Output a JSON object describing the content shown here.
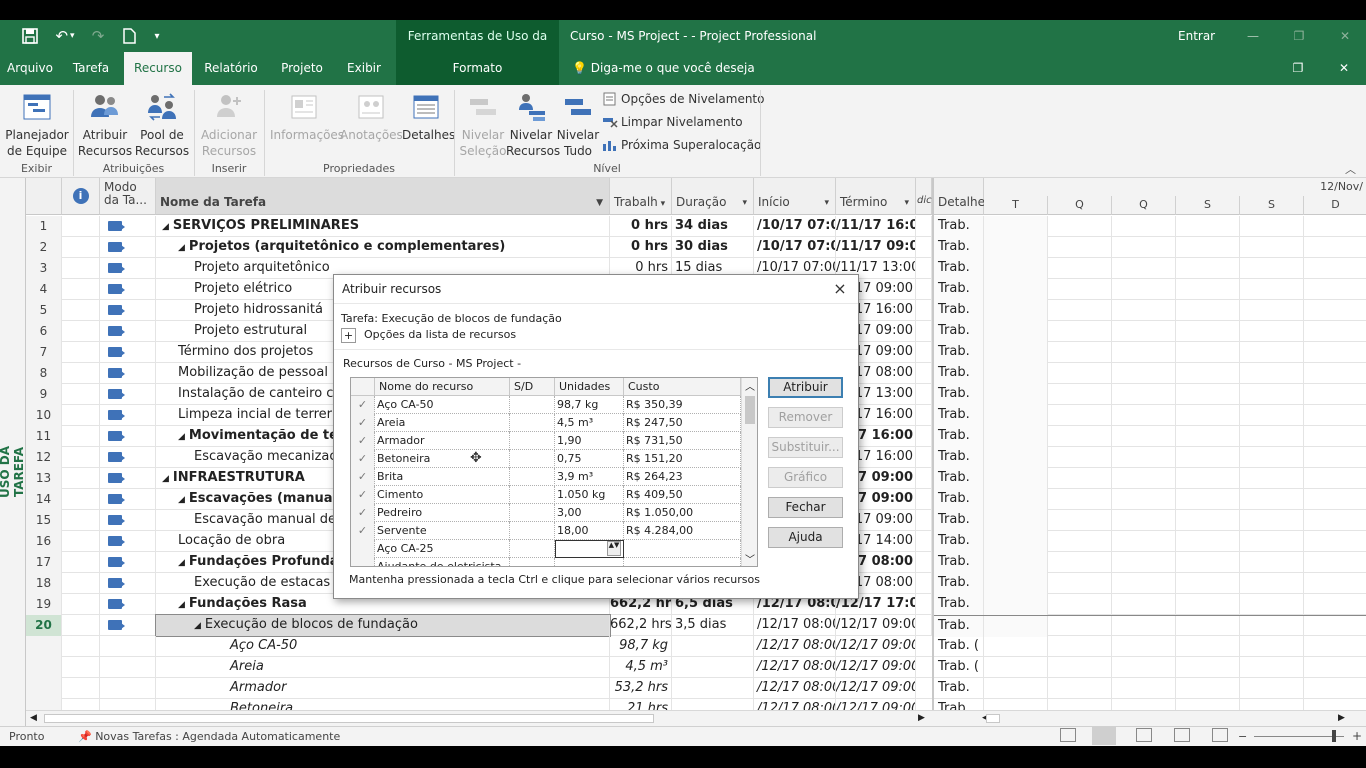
{
  "quick_access": {
    "save_icon": "save-icon",
    "undo_icon": "undo-icon",
    "redo_icon": "redo-icon",
    "new_icon": "new-file-icon",
    "customize_icon": "customize-qat-icon"
  },
  "window": {
    "contextual_header": "Ferramentas de Uso da Tarefa",
    "title": "Curso - MS Project -  -  Project Professional",
    "signin": "Entrar"
  },
  "tabs": [
    "Arquivo",
    "Tarefa",
    "Recurso",
    "Relatório",
    "Projeto",
    "Exibir"
  ],
  "contextual_tab": "Formato",
  "tell_me": "Diga-me o que você deseja fazer",
  "ribbon": {
    "team_planner": "Planejador\nde Equipe",
    "assign_resources": "Atribuir\nRecursos",
    "resource_pool": "Pool de\nRecursos",
    "add_resources": "Adicionar\nRecursos",
    "information": "Informações",
    "notes": "Anotações",
    "details": "Detalhes",
    "level_selection": "Nivelar\nSeleção",
    "level_resources": "Nivelar\nRecursos",
    "level_all": "Nivelar\nTudo",
    "leveling_options": "Opções de Nivelamento",
    "clear_leveling": "Limpar Nivelamento",
    "next_overallocation": "Próxima Superalocação",
    "groups": {
      "view": "Exibir",
      "assignments": "Atribuições",
      "insert": "Inserir",
      "properties": "Propriedades",
      "level": "Nível"
    }
  },
  "view_label": "USO DA TAREFA",
  "grid": {
    "headers": {
      "info": "i",
      "mode": "Modo da Ta...",
      "name": "Nome da Tarefa",
      "work": "Trabalh",
      "duration": "Duração",
      "start": "Início",
      "finish": "Término",
      "extra": "dic",
      "detail": "Detalhe"
    },
    "rows": [
      {
        "id": "1",
        "name": "SERVIÇOS PRELIMINARES",
        "level": 0,
        "bold": true,
        "work": "0 hrs",
        "duration": "34 dias",
        "start": "/10/17 07:00",
        "finish": "/11/17 16:00",
        "detail": "Trab."
      },
      {
        "id": "2",
        "name": "Projetos (arquitetônico e complementares)",
        "level": 1,
        "bold": true,
        "work": "0 hrs",
        "duration": "30 dias",
        "start": "/10/17 07:00",
        "finish": "/11/17 09:00",
        "detail": "Trab."
      },
      {
        "id": "3",
        "name": "Projeto arquitetônico",
        "level": 2,
        "bold": false,
        "work": "0 hrs",
        "duration": "15 dias",
        "start": "/10/17 07:00",
        "finish": "/11/17 13:00",
        "detail": "Trab."
      },
      {
        "id": "4",
        "name": "Projeto elétrico",
        "level": 2,
        "bold": false,
        "work": "",
        "duration": "",
        "start": "",
        "finish": "/17 09:00",
        "detail": "Trab."
      },
      {
        "id": "5",
        "name": "Projeto hidrossanitá",
        "level": 2,
        "bold": false,
        "work": "",
        "duration": "",
        "start": "",
        "finish": "/17 16:00",
        "detail": "Trab."
      },
      {
        "id": "6",
        "name": "Projeto estrutural",
        "level": 2,
        "bold": false,
        "work": "",
        "duration": "",
        "start": "",
        "finish": "/17 09:00",
        "detail": "Trab."
      },
      {
        "id": "7",
        "name": "Término dos projetos",
        "level": 1,
        "bold": false,
        "work": "",
        "duration": "",
        "start": "",
        "finish": "/17 09:00",
        "detail": "Trab."
      },
      {
        "id": "8",
        "name": "Mobilização de pessoal",
        "level": 1,
        "bold": false,
        "work": "",
        "duration": "",
        "start": "",
        "finish": "/17 08:00",
        "detail": "Trab."
      },
      {
        "id": "9",
        "name": "Instalação de canteiro c",
        "level": 1,
        "bold": false,
        "work": "",
        "duration": "",
        "start": "",
        "finish": "/17 13:00",
        "detail": "Trab."
      },
      {
        "id": "10",
        "name": "Limpeza incial de terrer",
        "level": 1,
        "bold": false,
        "work": "",
        "duration": "",
        "start": "",
        "finish": "/17 16:00",
        "detail": "Trab."
      },
      {
        "id": "11",
        "name": "Movimentação de terra",
        "level": 1,
        "bold": true,
        "work": "",
        "duration": "",
        "start": "",
        "finish": "/17 16:00",
        "detail": "Trab."
      },
      {
        "id": "12",
        "name": "Escavação mecanizac",
        "level": 2,
        "bold": false,
        "work": "",
        "duration": "",
        "start": "",
        "finish": "/17 16:00",
        "detail": "Trab."
      },
      {
        "id": "13",
        "name": "INFRAESTRUTURA",
        "level": 0,
        "bold": true,
        "work": "",
        "duration": "",
        "start": "",
        "finish": "/17 09:00",
        "detail": "Trab."
      },
      {
        "id": "14",
        "name": "Escavações (manual ou",
        "level": 1,
        "bold": true,
        "work": "",
        "duration": "",
        "start": "",
        "finish": "/17 09:00",
        "detail": "Trab."
      },
      {
        "id": "15",
        "name": "Escavação manual de",
        "level": 2,
        "bold": false,
        "work": "",
        "duration": "",
        "start": "",
        "finish": "/17 09:00",
        "detail": "Trab."
      },
      {
        "id": "16",
        "name": "Locação de obra",
        "level": 1,
        "bold": false,
        "work": "",
        "duration": "",
        "start": "",
        "finish": "/17 14:00",
        "detail": "Trab."
      },
      {
        "id": "17",
        "name": "Fundações Profundas",
        "level": 1,
        "bold": true,
        "work": "",
        "duration": "",
        "start": "",
        "finish": "/17 08:00",
        "detail": "Trab."
      },
      {
        "id": "18",
        "name": "Execução de estacas",
        "level": 2,
        "bold": false,
        "work": "",
        "duration": "",
        "start": "",
        "finish": "/17 08:00",
        "detail": "Trab."
      },
      {
        "id": "19",
        "name": "Fundações Rasa",
        "level": 1,
        "bold": true,
        "work": "662,2 hrs",
        "duration": "6,5 dias",
        "start": "/12/17 08:00",
        "finish": "/12/17 17:00",
        "detail": "Trab."
      },
      {
        "id": "20",
        "name": "Execução de blocos de fundação",
        "level": 2,
        "bold": false,
        "work": "662,2 hrs",
        "duration": "3,5 dias",
        "start": "/12/17 08:00",
        "finish": "/12/17 09:00",
        "detail": "Trab."
      }
    ],
    "assignments": [
      {
        "name": "Aço CA-50",
        "work": "98,7 kg",
        "start": "/12/17 08:00",
        "finish": "/12/17 09:00",
        "detail": "Trab. ("
      },
      {
        "name": "Areia",
        "work": "4,5 m³",
        "start": "/12/17 08:00",
        "finish": "/12/17 09:00",
        "detail": "Trab. ("
      },
      {
        "name": "Armador",
        "work": "53,2 hrs",
        "start": "/12/17 08:00",
        "finish": "/12/17 09:00",
        "detail": "Trab."
      },
      {
        "name": "Betoneira",
        "work": "21 hrs",
        "start": "/12/17 08:00",
        "finish": "/12/17 09:00",
        "detail": "Trab."
      }
    ]
  },
  "timescale": {
    "date": "12/Nov/",
    "days": [
      "T",
      "Q",
      "Q",
      "S",
      "S",
      "D"
    ]
  },
  "dialog": {
    "title": "Atribuir recursos",
    "task": "Tarefa: Execução de blocos de fundação",
    "options_toggle": "+",
    "options": "Opções da lista de recursos",
    "resources_from": "Recursos de Curso - MS Project -",
    "columns": [
      "Nome do recurso",
      "S/D",
      "Unidades",
      "Custo"
    ],
    "rows": [
      {
        "check": "✓",
        "name": "Aço CA-50",
        "units": "98,7 kg",
        "cost": "R$ 350,39"
      },
      {
        "check": "✓",
        "name": "Areia",
        "units": "4,5 m³",
        "cost": "R$ 247,50"
      },
      {
        "check": "✓",
        "name": "Armador",
        "units": "1,90",
        "cost": "R$ 731,50"
      },
      {
        "check": "✓",
        "name": "Betoneira",
        "units": "0,75",
        "cost": "R$ 151,20"
      },
      {
        "check": "✓",
        "name": "Brita",
        "units": "3,9 m³",
        "cost": "R$ 264,23"
      },
      {
        "check": "✓",
        "name": "Cimento",
        "units": "1.050 kg",
        "cost": "R$ 409,50"
      },
      {
        "check": "✓",
        "name": "Pedreiro",
        "units": "3,00",
        "cost": "R$ 1.050,00"
      },
      {
        "check": "✓",
        "name": "Servente",
        "units": "18,00",
        "cost": "R$ 4.284,00"
      },
      {
        "check": "",
        "name": "Aço CA-25",
        "units": "",
        "cost": ""
      },
      {
        "check": "",
        "name": "Ajudante de eletricista",
        "units": "",
        "cost": ""
      }
    ],
    "hint": "Mantenha pressionada a tecla Ctrl e clique para selecionar vários recursos",
    "buttons": {
      "assign": "Atribuir",
      "remove": "Remover",
      "replace": "Substituir...",
      "graphs": "Gráfico",
      "close": "Fechar",
      "help": "Ajuda"
    },
    "close_icon": "×"
  },
  "status": {
    "ready": "Pronto",
    "new_tasks": "Novas Tarefas : Agendada Automaticamente"
  }
}
